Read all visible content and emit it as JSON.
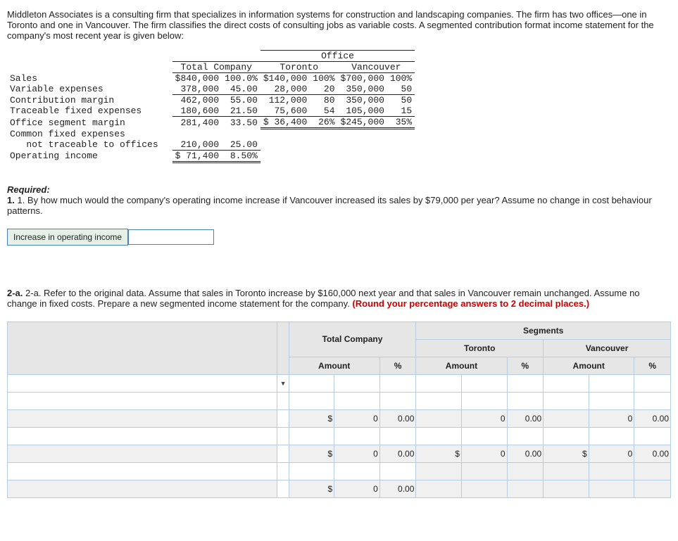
{
  "intro": "Middleton Associates is a consulting firm that specializes in information systems for construction and landscaping companies. The firm has two offices—one in Toronto and one in Vancouver. The firm classifies the direct costs of consulting jobs as variable costs. A segmented contribution format income statement for the company's most recent year is given below:",
  "fin": {
    "office_hdr": "Office",
    "cols": {
      "total": "Total Company",
      "tor": "Toronto",
      "van": "Vancouver"
    },
    "rows": {
      "sales": {
        "label": "Sales",
        "ta": "$840,000",
        "tp": "100.0%",
        "ra": "$140,000",
        "rp": "100%",
        "va": "$700,000",
        "vp": "100%"
      },
      "varexp": {
        "label": "Variable expenses",
        "ta": "378,000",
        "tp": "45.00",
        "ra": "28,000",
        "rp": "20",
        "va": "350,000",
        "vp": "50"
      },
      "cm": {
        "label": "Contribution margin",
        "ta": "462,000",
        "tp": "55.00",
        "ra": "112,000",
        "rp": "80",
        "va": "350,000",
        "vp": "50"
      },
      "tfix": {
        "label": "Traceable fixed expenses",
        "ta": "180,600",
        "tp": "21.50",
        "ra": "75,600",
        "rp": "54",
        "va": "105,000",
        "vp": "15"
      },
      "osm": {
        "label": "Office segment margin",
        "ta": "281,400",
        "tp": "33.50",
        "ra": "$ 36,400",
        "rp": "26%",
        "va": "$245,000",
        "vp": "35%"
      },
      "cfix1": {
        "label": "Common fixed expenses"
      },
      "cfix2": {
        "label": "   not traceable to offices",
        "ta": "210,000",
        "tp": "25.00"
      },
      "oi": {
        "label": "Operating income",
        "ta": "$ 71,400",
        "tp": "8.50%"
      }
    }
  },
  "required_hdr": "Required:",
  "q1": "1. By how much would the company's operating income increase if Vancouver increased its sales by $79,000 per year? Assume no change in cost behaviour patterns.",
  "q1_label": "Increase in operating income",
  "q2a_plain": "2-a. Refer to the original data. Assume that sales in Toronto increase by $160,000 next year and that sales in Vancouver remain unchanged. Assume no change in fixed costs. Prepare a new segmented income statement for the company. ",
  "q2a_red": "(Round your percentage answers to 2 decimal places.)",
  "grid": {
    "segments": "Segments",
    "total": "Total Company",
    "tor": "Toronto",
    "van": "Vancouver",
    "amount": "Amount",
    "pct": "%",
    "arrow": "▼",
    "cells": {
      "r3": {
        "ta_cur": "$",
        "ta": "0",
        "tp": "0.00",
        "ra": "0",
        "rp": "0.00",
        "va": "0",
        "vp": "0.00"
      },
      "r5": {
        "ta_cur": "$",
        "ta": "0",
        "tp": "0.00",
        "ra_cur": "$",
        "ra": "0",
        "rp": "0.00",
        "va_cur": "$",
        "va": "0",
        "vp": "0.00"
      },
      "r7": {
        "ta_cur": "$",
        "ta": "0",
        "tp": "0.00"
      }
    }
  }
}
